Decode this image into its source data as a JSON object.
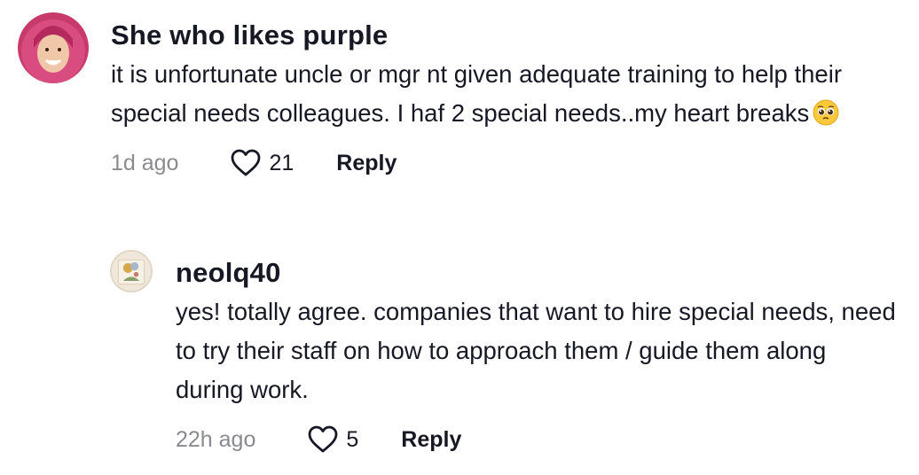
{
  "comments": [
    {
      "username": "She who likes purple",
      "text": "it is unfortunate uncle or mgr nt given adequate training to help their special needs colleagues. I haf 2 special needs..my heart breaks",
      "emoji": "pleading-face-emoji",
      "time": "1d ago",
      "likes": "21",
      "reply_label": "Reply",
      "avatar_icon": "user-avatar-pink-hijab"
    },
    {
      "username": "neolq40",
      "text": "yes! totally agree. companies that want to hire special needs, need to try their staff on how to approach them / guide them along during work.",
      "time": "22h ago",
      "likes": "5",
      "reply_label": "Reply",
      "avatar_icon": "user-avatar-photo"
    }
  ],
  "colors": {
    "text": "#161823",
    "muted": "#8a8b91"
  }
}
